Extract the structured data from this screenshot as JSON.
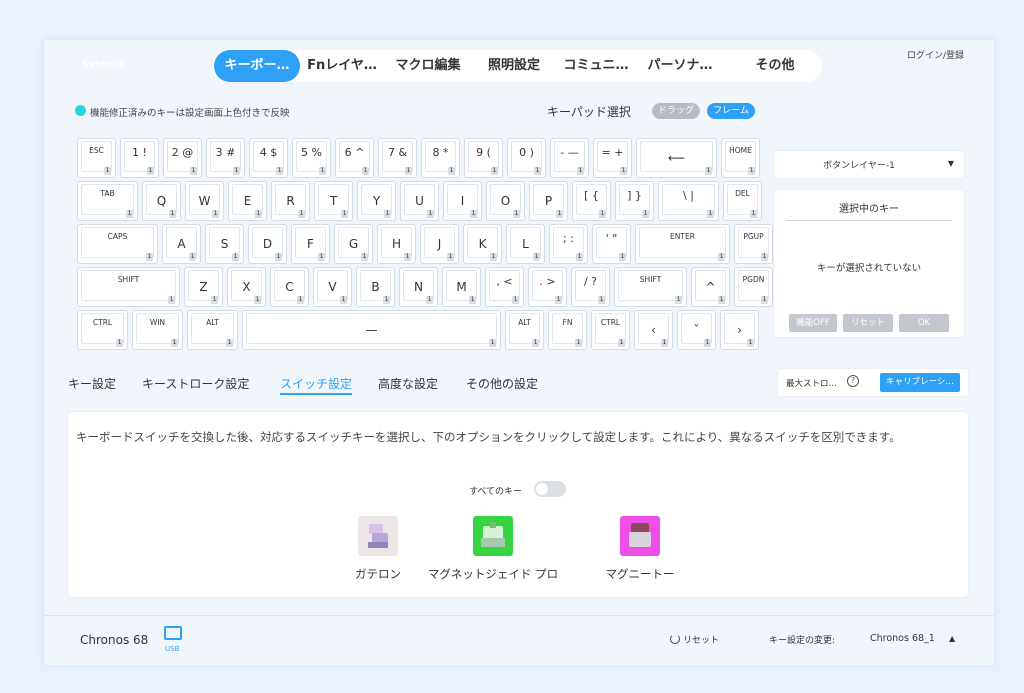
{
  "header": {
    "logo": "Syntech",
    "tabs": [
      "キーボー…",
      "Fnレイヤ…",
      "マクロ編集",
      "照明設定",
      "コミュニ…",
      "パーソナ…",
      "その他"
    ],
    "login": "ログイン/登録"
  },
  "info": {
    "notice": "機能修正済みのキーは設定画面上色付きで反映",
    "keypad_label": "キーパッド選択",
    "drag_label": "ドラッグ",
    "frame_label": "フレーム"
  },
  "keyboard": {
    "layer_badge": "1",
    "rows": [
      [
        "ESC",
        "1 !",
        "2 @",
        "3 #",
        "4 $",
        "5 %",
        "6 ^",
        "7 &",
        "8 *",
        "9 (",
        "0 )",
        "- —",
        "= +",
        "⟵",
        "HOME"
      ],
      [
        "TAB",
        "Q",
        "W",
        "E",
        "R",
        "T",
        "Y",
        "U",
        "I",
        "O",
        "P",
        "[ {",
        "] }",
        "\\ |",
        "DEL"
      ],
      [
        "CAPS",
        "A",
        "S",
        "D",
        "F",
        "G",
        "H",
        "J",
        "K",
        "L",
        "; :",
        "' \"",
        "ENTER",
        "PGUP"
      ],
      [
        "SHIFT",
        "Z",
        "X",
        "C",
        "V",
        "B",
        "N",
        "M",
        ", <",
        ". >",
        "/ ?",
        "SHIFT",
        "^",
        "PGDN"
      ],
      [
        "CTRL",
        "WIN",
        "ALT",
        "—",
        "ALT",
        "FN",
        "CTRL",
        "‹",
        "ˇ",
        "›"
      ]
    ]
  },
  "side": {
    "layer_select": "ボタンレイヤー-1",
    "selected_title": "選択中のキー",
    "no_selection": "キーが選択されていない",
    "btn_off": "機能OFF",
    "btn_reset": "リセット",
    "btn_ok": "OK"
  },
  "subtabs": [
    "キー設定",
    "キーストローク設定",
    "スイッチ設定",
    "高度な設定",
    "その他の設定"
  ],
  "stroke": {
    "label": "最大ストロ…",
    "help": "?",
    "calibrate": "キャリブレーシ…"
  },
  "content": {
    "description": "キーボードスイッチを交換した後、対応するスイッチキーを選択し、下のオプションをクリックして設定します。これにより、異なるスイッチを区別できます。",
    "all_keys": "すべてのキー",
    "switches": [
      {
        "name": "ガテロン",
        "color": "#ece6e6"
      },
      {
        "name": "マグネットジェイド プロ",
        "color": "#35d440"
      },
      {
        "name": "マグニートー",
        "color": "#ef4fe6"
      }
    ]
  },
  "footer": {
    "keyboard_name": "Chronos 68",
    "usb_label": "USB",
    "reset": "リセット",
    "key_setting_label": "キー設定の変更:",
    "key_setting_value": "Chronos 68_1"
  },
  "colors": {
    "accent": "#2ea0f5",
    "info_dot": "#21d8dc"
  }
}
